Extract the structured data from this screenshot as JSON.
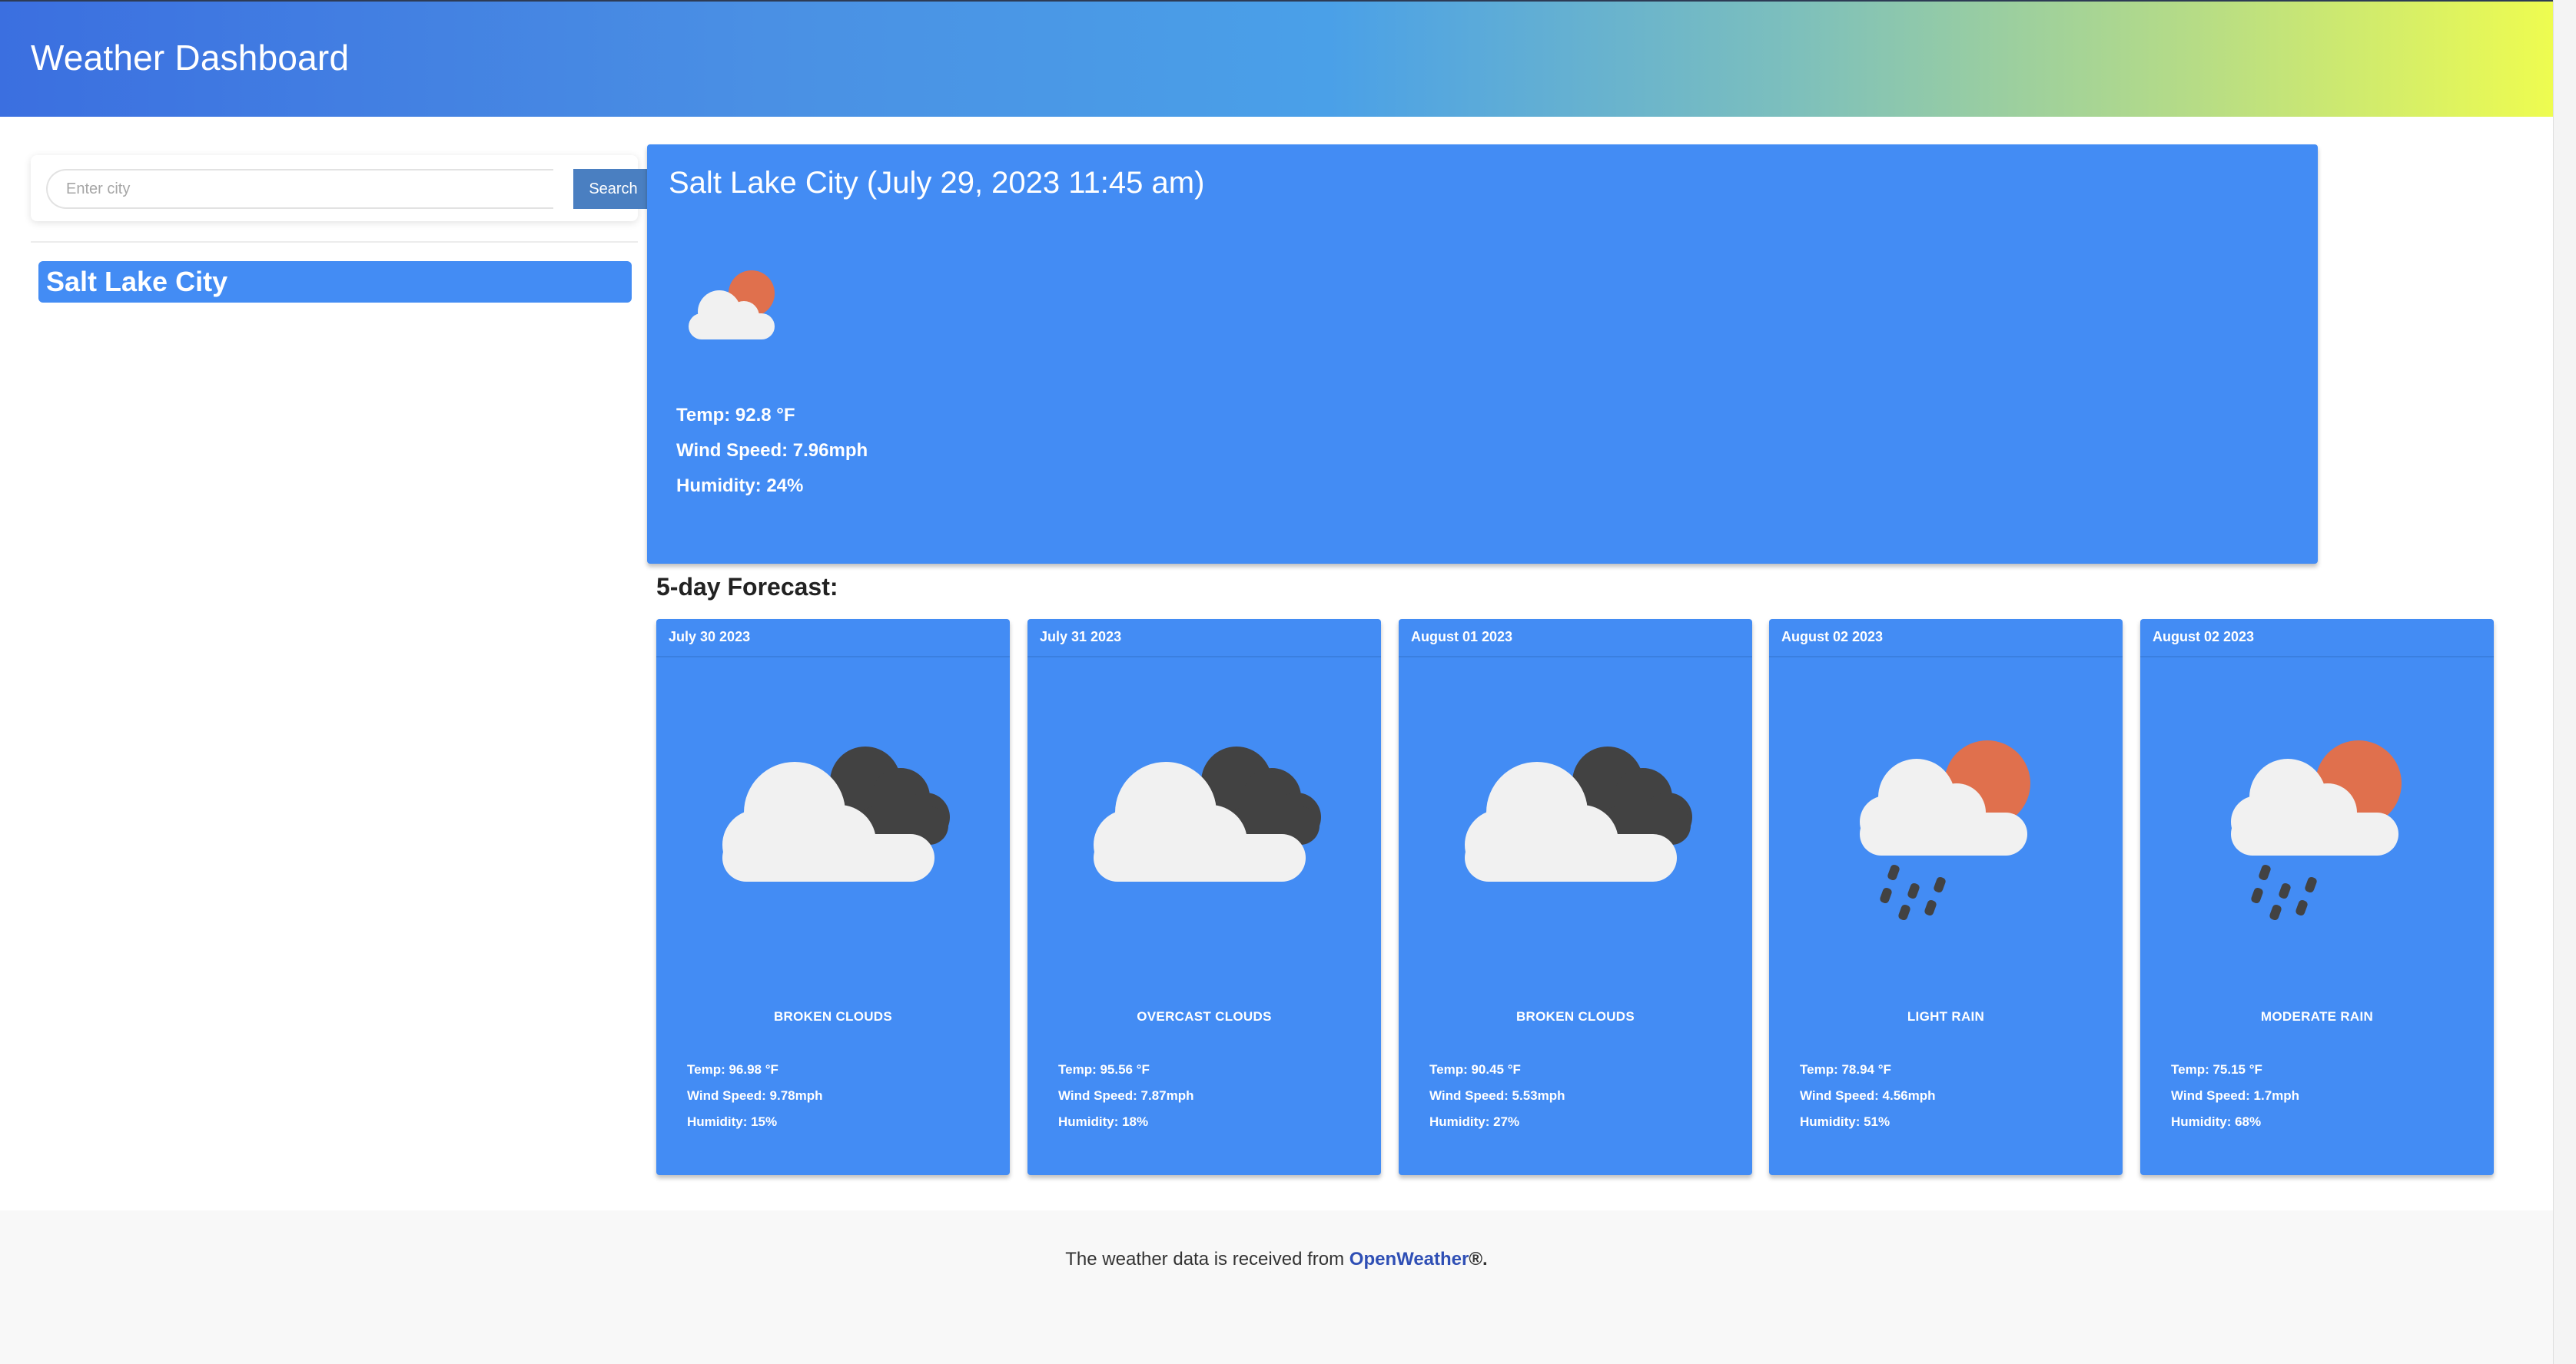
{
  "header": {
    "title": "Weather Dashboard"
  },
  "search": {
    "placeholder": "Enter city",
    "value": "",
    "button_label": "Search"
  },
  "history": [
    {
      "label": "Salt Lake City"
    }
  ],
  "current": {
    "title": "Salt Lake City (July 29, 2023 11:45 am)",
    "icon": "cloud-sun-icon",
    "temp": "Temp: 92.8 °F",
    "wind": "Wind Speed: 7.96mph",
    "humidity": "Humidity: 24%"
  },
  "forecast": {
    "heading": "5-day Forecast:",
    "days": [
      {
        "date": "July 30 2023",
        "icon": "broken-clouds-icon",
        "description": "BROKEN CLOUDS",
        "temp": "Temp: 96.98 °F",
        "wind": "Wind Speed: 9.78mph",
        "humidity": "Humidity: 15%"
      },
      {
        "date": "July 31 2023",
        "icon": "overcast-clouds-icon",
        "description": "OVERCAST CLOUDS",
        "temp": "Temp: 95.56 °F",
        "wind": "Wind Speed: 7.87mph",
        "humidity": "Humidity: 18%"
      },
      {
        "date": "August 01 2023",
        "icon": "broken-clouds-icon",
        "description": "BROKEN CLOUDS",
        "temp": "Temp: 90.45 °F",
        "wind": "Wind Speed: 5.53mph",
        "humidity": "Humidity: 27%"
      },
      {
        "date": "August 02 2023",
        "icon": "rain-sun-icon",
        "description": "LIGHT RAIN",
        "temp": "Temp: 78.94 °F",
        "wind": "Wind Speed: 4.56mph",
        "humidity": "Humidity: 51%"
      },
      {
        "date": "August 02 2023",
        "icon": "rain-sun-icon",
        "description": "MODERATE RAIN",
        "temp": "Temp: 75.15 °F",
        "wind": "Wind Speed: 1.7mph",
        "humidity": "Humidity: 68%"
      }
    ]
  },
  "footer": {
    "text": "The weather data is received from ",
    "link": "OpenWeather",
    "mark": "®."
  },
  "colors": {
    "card": "#438cf4",
    "sun": "#e0704d",
    "dark_cloud": "#424242",
    "light_cloud": "#f1f1f1",
    "link": "#2f4fb5"
  }
}
